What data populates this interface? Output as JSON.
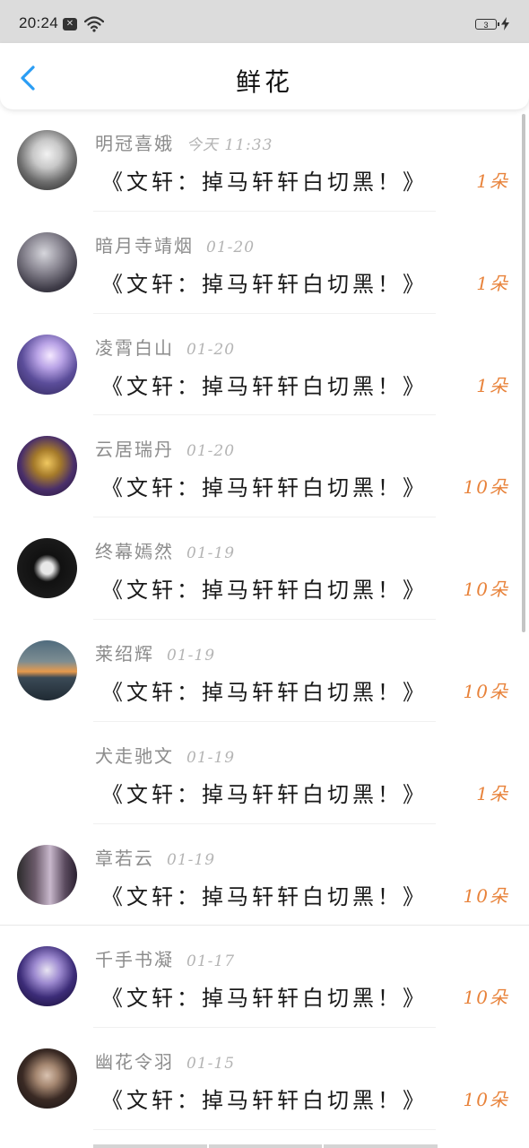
{
  "status_bar": {
    "time": "20:24",
    "battery": "3",
    "notification_badge": "✕",
    "icons": [
      "notification-icon",
      "wifi-icon",
      "battery-icon",
      "charging-icon"
    ]
  },
  "header": {
    "title": "鲜花",
    "back_icon": "chevron-left-icon",
    "accent_color": "#2a9df4"
  },
  "colors": {
    "count": "#e8823a",
    "username": "#8c8c8c",
    "time": "#b4b4b4"
  },
  "items": [
    {
      "user": "明冠喜娥",
      "time": "今天 11:33",
      "title": "《文轩：掉马轩轩白切黑！》",
      "count": "1朵",
      "avatar": "avatar-1"
    },
    {
      "user": "暗月寺靖烟",
      "time": "01-20",
      "title": "《文轩：掉马轩轩白切黑！》",
      "count": "1朵",
      "avatar": "avatar-2"
    },
    {
      "user": "凌霄白山",
      "time": "01-20",
      "title": "《文轩：掉马轩轩白切黑！》",
      "count": "1朵",
      "avatar": "avatar-3"
    },
    {
      "user": "云居瑞丹",
      "time": "01-20",
      "title": "《文轩：掉马轩轩白切黑！》",
      "count": "10朵",
      "avatar": "avatar-4"
    },
    {
      "user": "终幕嫣然",
      "time": "01-19",
      "title": "《文轩：掉马轩轩白切黑！》",
      "count": "10朵",
      "avatar": "avatar-5"
    },
    {
      "user": "莱绍辉",
      "time": "01-19",
      "title": "《文轩：掉马轩轩白切黑！》",
      "count": "10朵",
      "avatar": "avatar-6"
    },
    {
      "user": "犬走驰文",
      "time": "01-19",
      "title": "《文轩：掉马轩轩白切黑！》",
      "count": "1朵",
      "avatar": ""
    },
    {
      "user": "章若云",
      "time": "01-19",
      "title": "《文轩：掉马轩轩白切黑！》",
      "count": "10朵",
      "avatar": "avatar-8"
    },
    {
      "user": "千手书凝",
      "time": "01-17",
      "title": "《文轩：掉马轩轩白切黑！》",
      "count": "10朵",
      "avatar": "avatar-9"
    },
    {
      "user": "幽花令羽",
      "time": "01-15",
      "title": "《文轩：掉马轩轩白切黑！》",
      "count": "10朵",
      "avatar": "avatar-10"
    }
  ]
}
